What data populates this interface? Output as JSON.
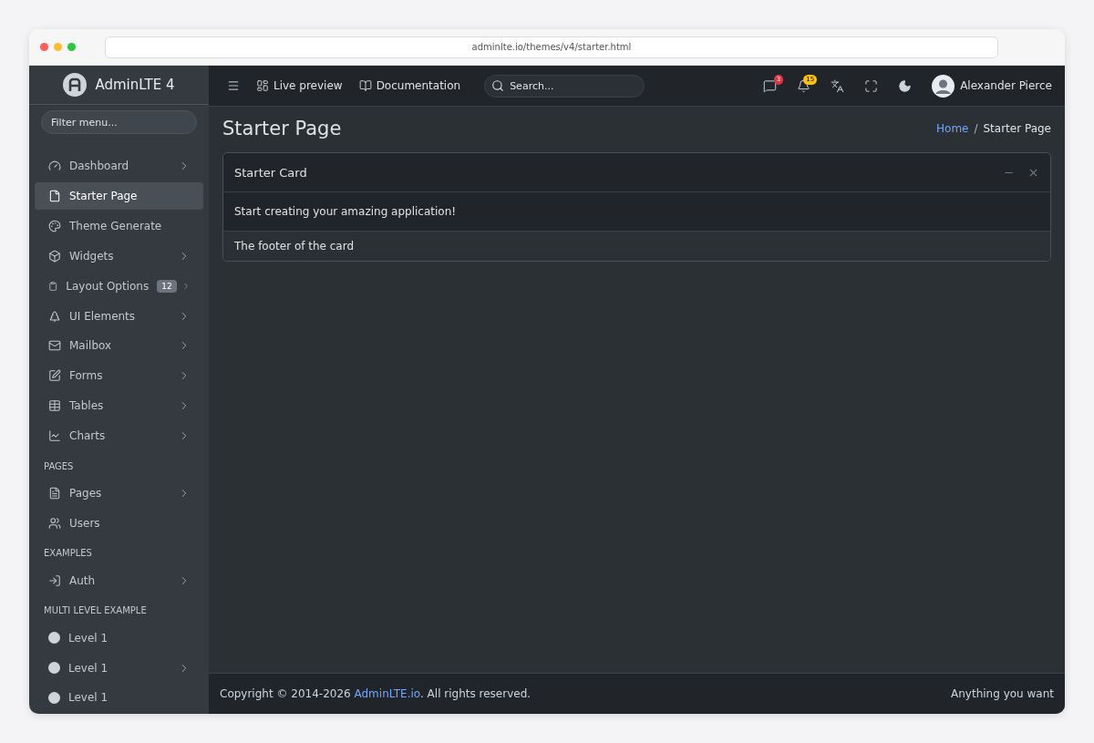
{
  "browser": {
    "url": "adminlte.io/themes/v4/starter.html"
  },
  "brand": {
    "name": "AdminLTE 4"
  },
  "sidebar": {
    "filter": {
      "placeholder": "Filter menu..."
    },
    "sections": [
      {
        "items": [
          {
            "label": "Dashboard",
            "kind": "icon",
            "selected": false,
            "expandable": true
          },
          {
            "label": "Starter Page",
            "kind": "icon",
            "selected": true,
            "expandable": false
          },
          {
            "label": "Theme Generate",
            "kind": "icon",
            "selected": false,
            "expandable": false
          },
          {
            "label": "Widgets",
            "kind": "icon",
            "selected": false,
            "expandable": true
          },
          {
            "label": "Layout Options",
            "kind": "icon",
            "selected": false,
            "expandable": true,
            "badge": "12"
          },
          {
            "label": "UI Elements",
            "kind": "icon",
            "selected": false,
            "expandable": true
          },
          {
            "label": "Mailbox",
            "kind": "icon",
            "selected": false,
            "expandable": true
          },
          {
            "label": "Forms",
            "kind": "icon",
            "selected": false,
            "expandable": true
          },
          {
            "label": "Tables",
            "kind": "icon",
            "selected": false,
            "expandable": true
          },
          {
            "label": "Charts",
            "kind": "icon",
            "selected": false,
            "expandable": true
          }
        ]
      },
      {
        "heading": "PAGES",
        "items": [
          {
            "label": "Pages",
            "kind": "icon",
            "selected": false,
            "expandable": true
          },
          {
            "label": "Users",
            "kind": "icon",
            "selected": false,
            "expandable": false
          }
        ]
      },
      {
        "heading": "EXAMPLES",
        "items": [
          {
            "label": "Auth",
            "kind": "icon",
            "selected": false,
            "expandable": true
          }
        ]
      },
      {
        "heading": "MULTI LEVEL EXAMPLE",
        "items": [
          {
            "label": "Level 1",
            "kind": "dot",
            "selected": false,
            "expandable": false
          },
          {
            "label": "Level 1",
            "kind": "dot",
            "selected": false,
            "expandable": true
          },
          {
            "label": "Level 1",
            "kind": "dot",
            "selected": false,
            "expandable": false
          }
        ]
      }
    ]
  },
  "navbar": {
    "links": [
      {
        "label": "Live preview"
      },
      {
        "label": "Documentation"
      }
    ],
    "search": {
      "placeholder": "Search..."
    },
    "badges": [
      {
        "count": "3",
        "color": "#dc3545"
      },
      {
        "count": "15",
        "color": "#ffc107"
      }
    ],
    "user": {
      "name": "Alexander Pierce"
    }
  },
  "page": {
    "title": "Starter Page",
    "breadcrumb_separator": "/",
    "breadcrumb": [
      {
        "label": "Home",
        "link": true
      },
      {
        "label": "Starter Page",
        "link": false
      }
    ],
    "card": {
      "title": "Starter Card",
      "body": "Start creating your amazing application!",
      "footer": "The footer of the card"
    }
  },
  "footer": {
    "copyright": "Copyright © 2014-2026 ",
    "link": "AdminLTE.io",
    "rest": ". All rights reserved.",
    "right": "Anything you want"
  }
}
